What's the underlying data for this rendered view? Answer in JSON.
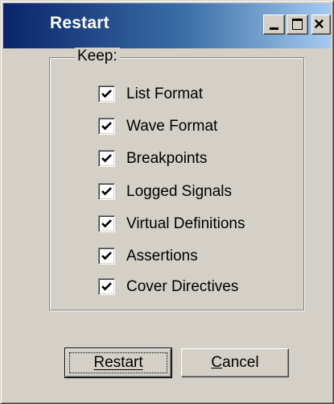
{
  "window": {
    "title": "Restart"
  },
  "title_buttons": {
    "minimize": "minimize-icon",
    "maximize": "maximize-icon",
    "close": "close-icon"
  },
  "group": {
    "label": "Keep:"
  },
  "options": [
    {
      "label": "List Format",
      "checked": true
    },
    {
      "label": "Wave Format",
      "checked": true
    },
    {
      "label": "Breakpoints",
      "checked": true
    },
    {
      "label": "Logged Signals",
      "checked": true
    },
    {
      "label": "Virtual Definitions",
      "checked": true
    },
    {
      "label": "Assertions",
      "checked": true
    },
    {
      "label": "Cover Directives",
      "checked": true
    }
  ],
  "buttons": {
    "restart": "Restart",
    "cancel": "Cancel"
  }
}
